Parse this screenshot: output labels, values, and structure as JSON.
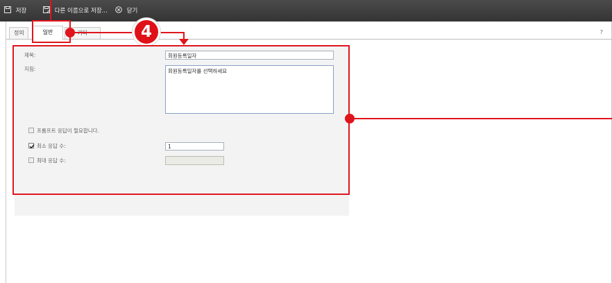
{
  "toolbar": {
    "save_label": "저장",
    "save_as_label": "다른 이름으로 저장...",
    "close_label": "닫기"
  },
  "tabs": [
    {
      "label": "정의"
    },
    {
      "label": "일반"
    },
    {
      "label": "기타"
    }
  ],
  "help": {
    "label": "?"
  },
  "form": {
    "title_label": "제목:",
    "title_value": "회원등록일자",
    "instruction_label": "지침:",
    "instruction_value": "회원등록일자를 선택하세요",
    "prompt_required_label": "프롬프트 응답이 필요합니다.",
    "min_answers_label": "최소 응답 수:",
    "min_answers_value": "1",
    "max_answers_label": "최대 응답 수:"
  },
  "annotation": {
    "badge_number": "4",
    "color": "#e0141c"
  },
  "colors": {
    "toolbar_bg": "#3d3d3d",
    "panel_bg": "#f3f3f3",
    "annotation_red": "#e0141c"
  }
}
